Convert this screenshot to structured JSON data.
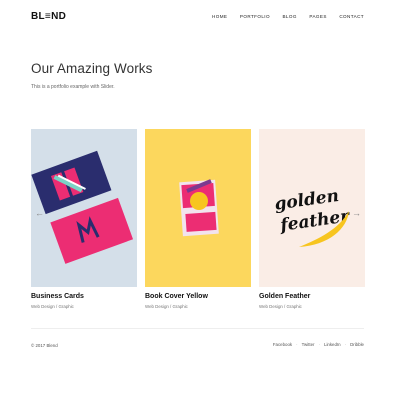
{
  "header": {
    "logo": "BL≡ND",
    "nav": [
      "HOME",
      "PORTFOLIO",
      "BLOG",
      "PAGES",
      "CONTACT"
    ]
  },
  "hero": {
    "title": "Our Amazing Works",
    "subtitle": "This is a portfolio example with Slider."
  },
  "cards": [
    {
      "title": "Business Cards",
      "category": "Web Design / Graphic",
      "bg": "#d4dfe9"
    },
    {
      "title": "Book Cover Yellow",
      "category": "Web Design / Graphic",
      "bg": "#fcd75d"
    },
    {
      "title": "Golden Feather",
      "category": "Web Design / Graphic",
      "bg": "#faede6"
    }
  ],
  "golden_feather_art": "golden feather",
  "footer": {
    "copyright": "© 2017 Blend",
    "social": [
      "Facebook",
      "Twitter",
      "LinkedIn",
      "Dribble"
    ]
  },
  "colors": {
    "accent_pink": "#ec2d73",
    "accent_navy": "#2a2d6e",
    "accent_yellow": "#f7c51f"
  }
}
